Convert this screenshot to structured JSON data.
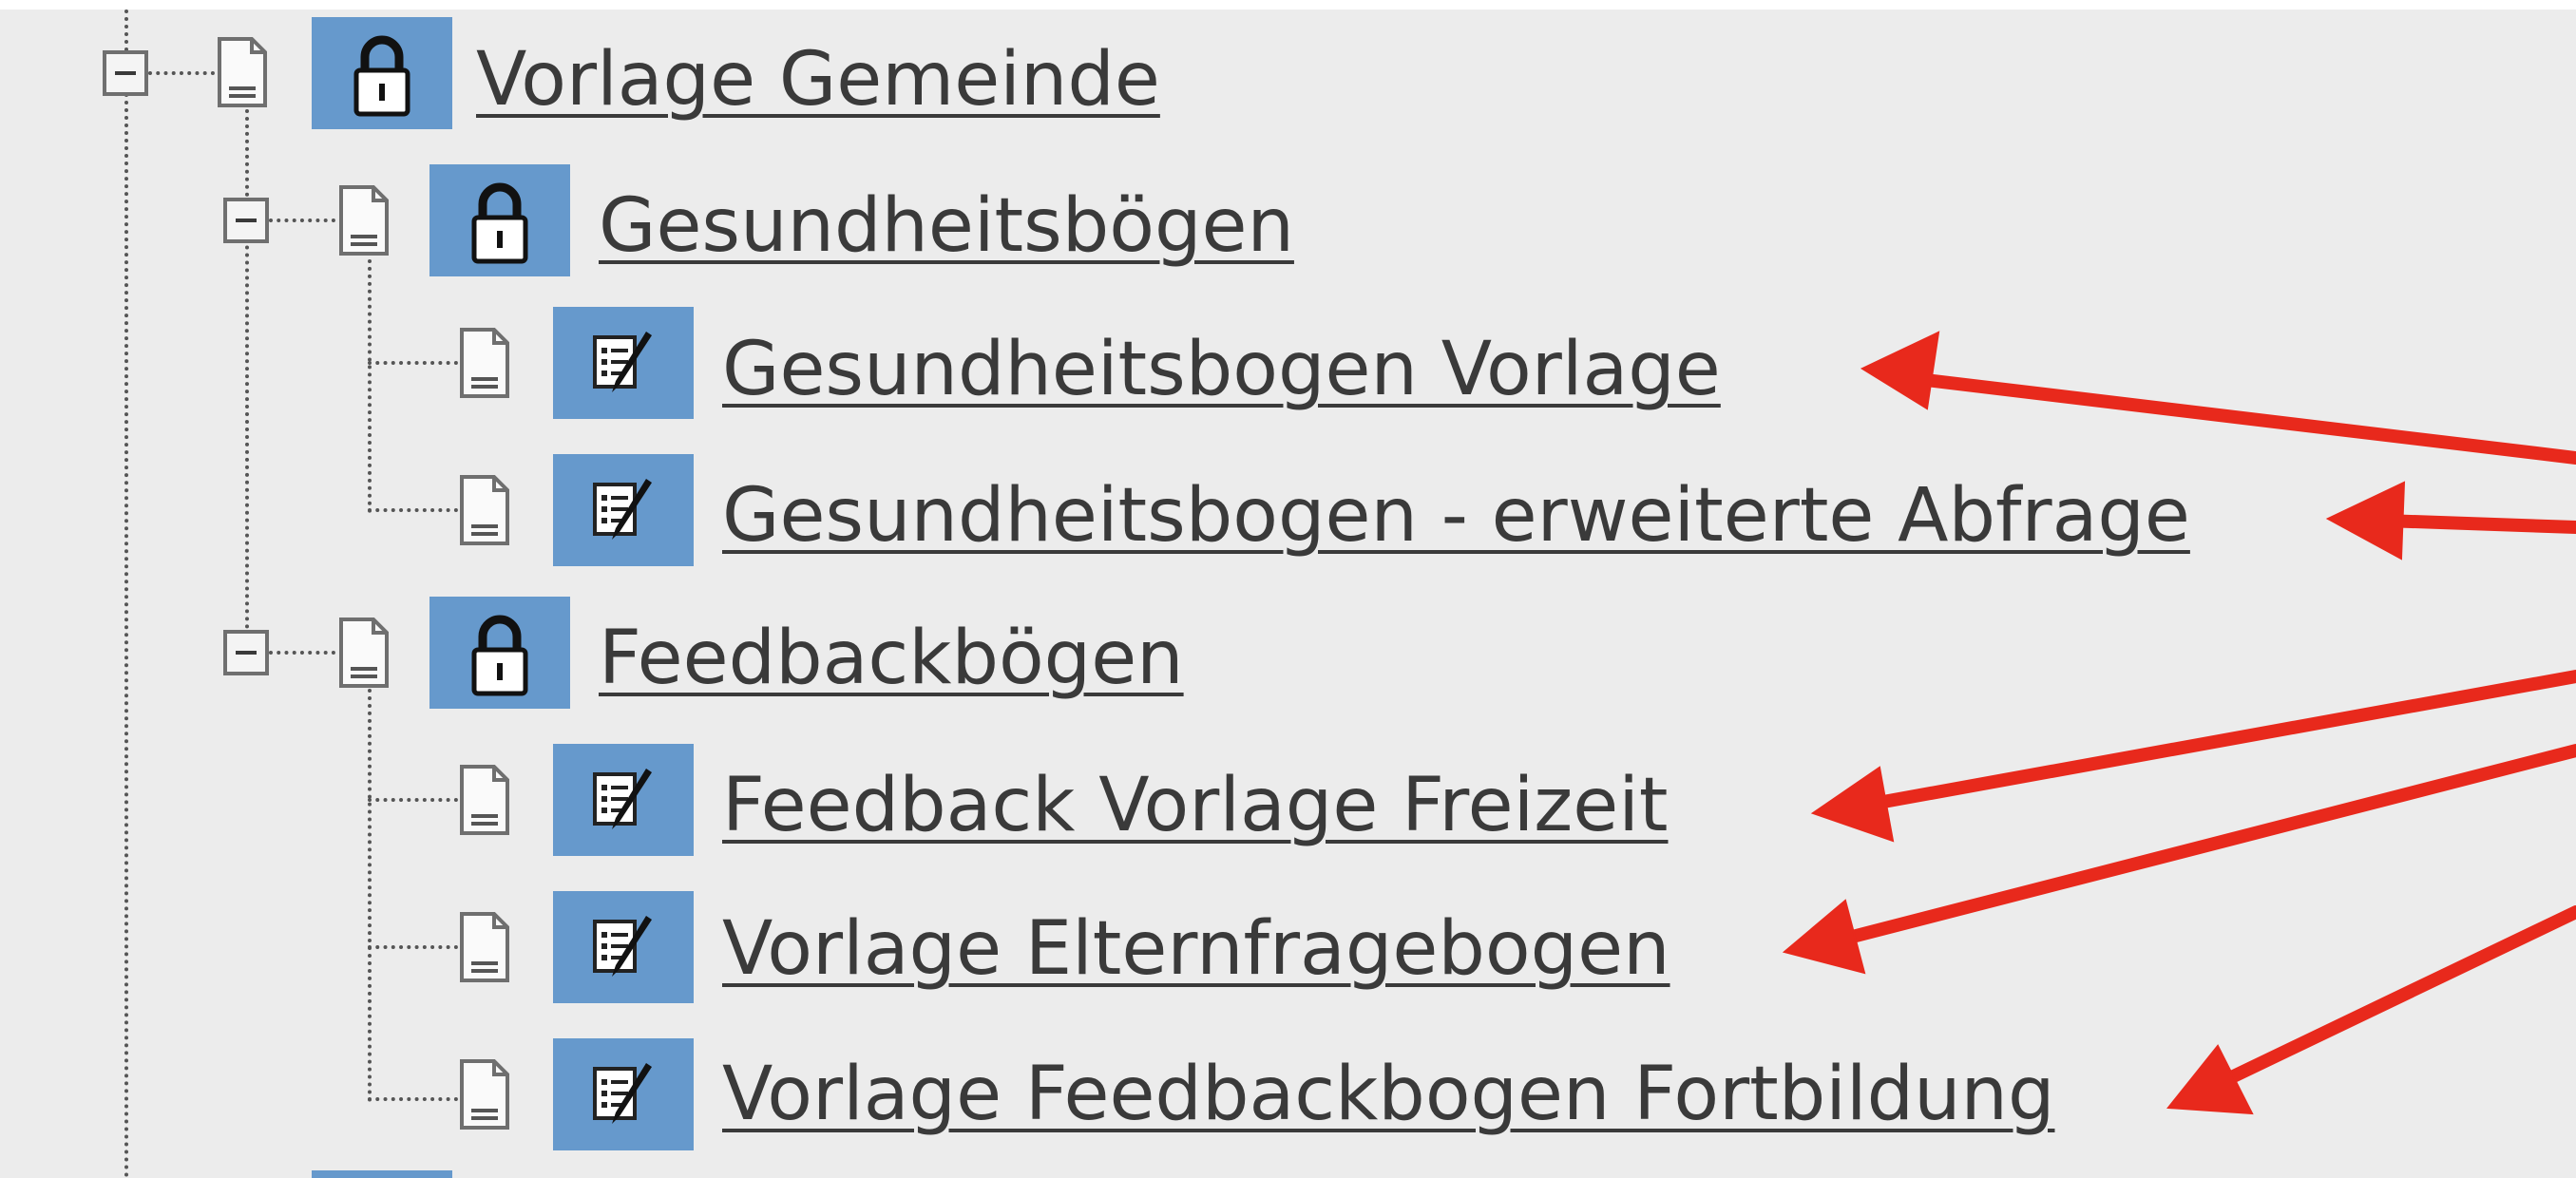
{
  "tree": {
    "root": {
      "label": "Vorlage Gemeinde",
      "icon": "lock-icon",
      "expanded": true
    },
    "groups": [
      {
        "label": "Gesundheitsbögen",
        "icon": "lock-icon",
        "expanded": true,
        "items": [
          {
            "label": "Gesundheitsbogen Vorlage",
            "icon": "edit-form-icon"
          },
          {
            "label": "Gesundheitsbogen - erweiterte Abfrage",
            "icon": "edit-form-icon"
          }
        ]
      },
      {
        "label": "Feedbackbögen",
        "icon": "lock-icon",
        "expanded": true,
        "items": [
          {
            "label": "Feedback Vorlage Freizeit",
            "icon": "edit-form-icon"
          },
          {
            "label": "Vorlage Elternfragebogen",
            "icon": "edit-form-icon"
          },
          {
            "label": "Vorlage Feedbackbogen Fortbildung",
            "icon": "edit-form-icon"
          }
        ]
      }
    ]
  },
  "colors": {
    "background": "#ececec",
    "icon_box": "#6699cc",
    "text": "#3a3a3a",
    "annotation_arrow": "#e8291c"
  }
}
